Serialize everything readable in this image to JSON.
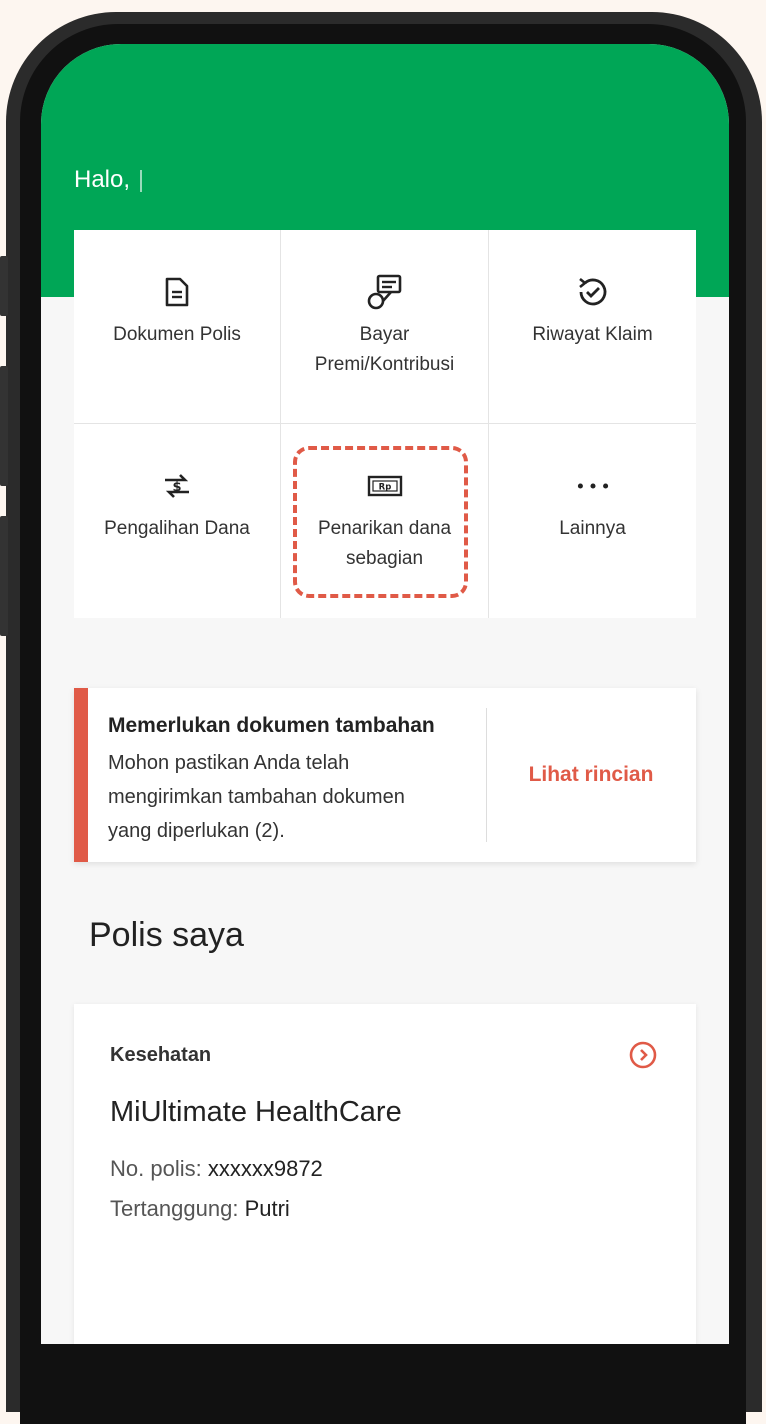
{
  "header": {
    "greeting": "Halo,"
  },
  "menu": {
    "items": [
      {
        "label": "Dokumen Polis",
        "icon": "document-icon"
      },
      {
        "label": "Bayar\nPremi/Kontribusi",
        "icon": "payment-icon"
      },
      {
        "label": "Riwayat Klaim",
        "icon": "history-icon"
      },
      {
        "label": "Pengalihan Dana",
        "icon": "fund-switch-icon"
      },
      {
        "label": "Penarikan dana\nsebagian",
        "icon": "rupiah-note-icon",
        "highlighted": true
      },
      {
        "label": "Lainnya",
        "icon": "more-dots-icon"
      }
    ]
  },
  "notice": {
    "title": "Memerlukan dokumen tambahan",
    "body": "Mohon pastikan Anda telah mengirimkan tambahan dokumen yang diperlukan (2).",
    "link": "Lihat rincian"
  },
  "policies": {
    "section_title": "Polis saya",
    "items": [
      {
        "category": "Kesehatan",
        "name": "MiUltimate HealthCare",
        "number_label": "No. polis:",
        "number_value": "xxxxxx9872",
        "insured_label": "Tertanggung:",
        "insured_value": "Putri"
      }
    ]
  },
  "colors": {
    "brand_green": "#00a656",
    "alert_red": "#e05a47"
  }
}
